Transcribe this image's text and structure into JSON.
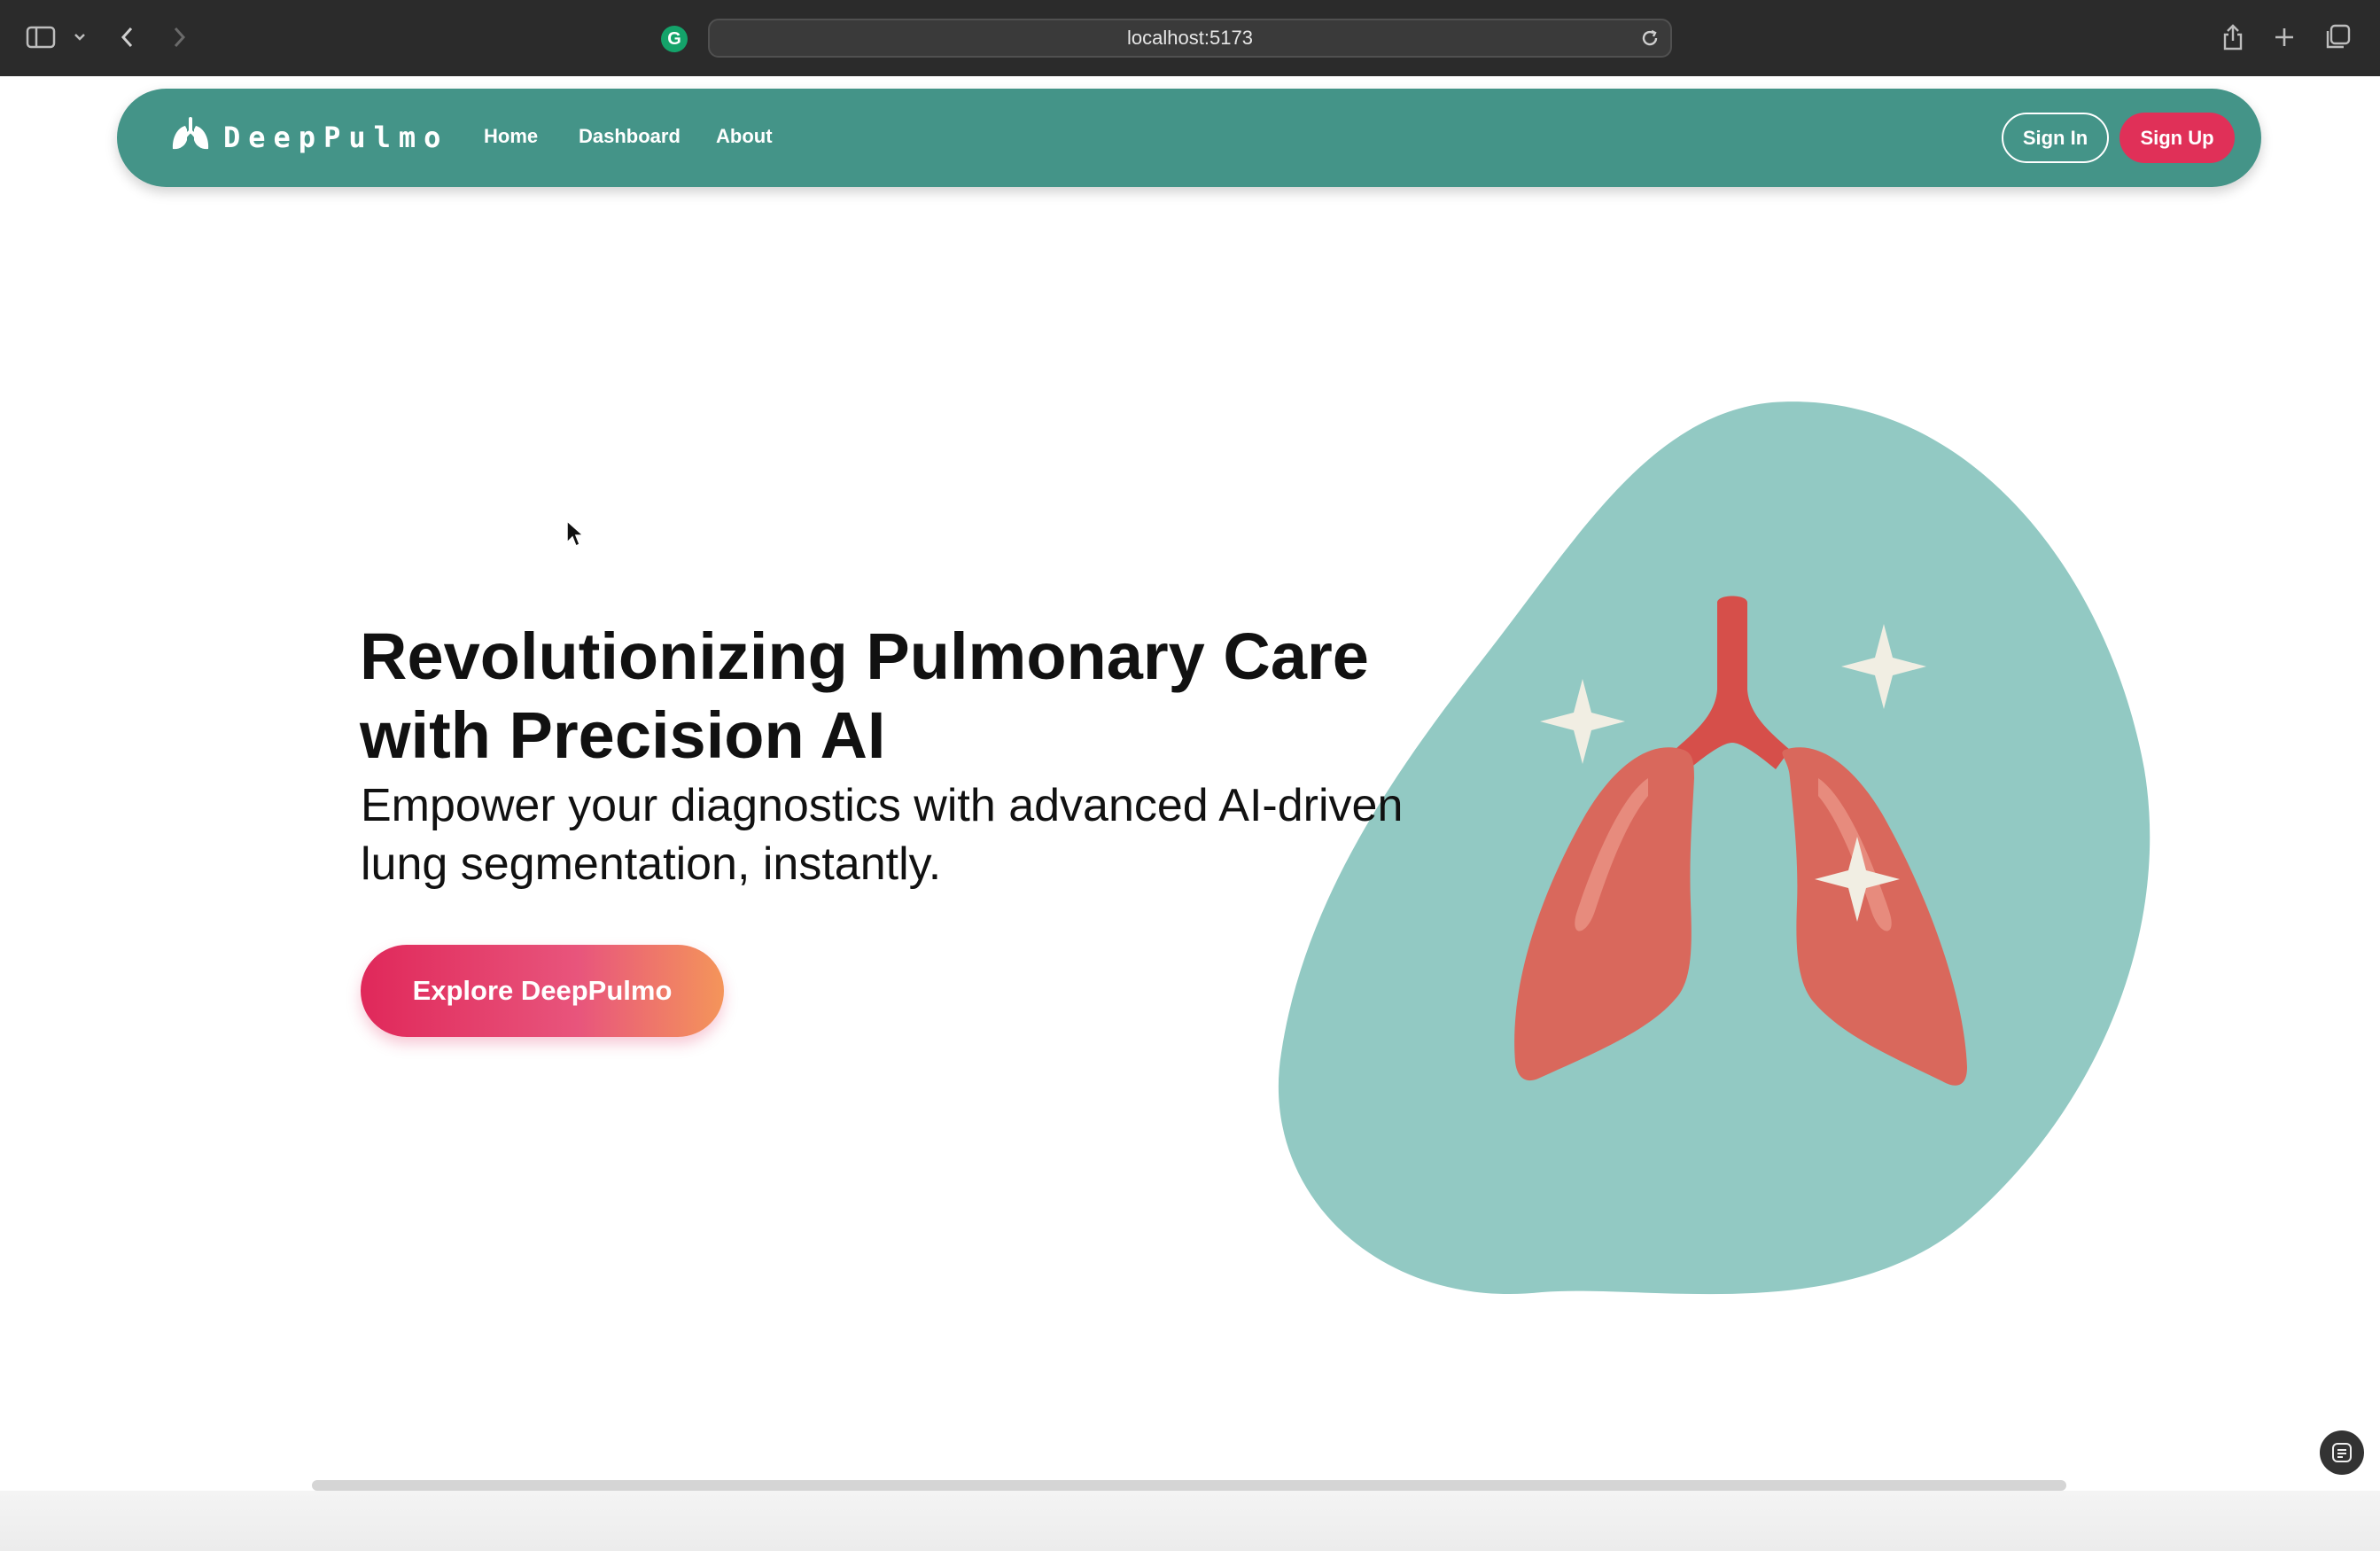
{
  "browser": {
    "url": "localhost:5173"
  },
  "nav": {
    "brand": "DeepPulmo",
    "links": [
      "Home",
      "Dashboard",
      "About"
    ],
    "sign_in": "Sign In",
    "sign_up": "Sign Up"
  },
  "hero": {
    "title_line1": "Revolutionizing Pulmonary Care",
    "title_line2": "with Precision AI",
    "subtitle_line1": "Empower your diagnostics with advanced AI-driven",
    "subtitle_line2": "lung segmentation, instantly.",
    "cta": "Explore DeepPulmo"
  },
  "colors": {
    "nav_bg": "#449488",
    "accent": "#e03058",
    "blob": "#92c9c3",
    "lung": "#d9685c"
  },
  "icons": [
    "sidebar-icon",
    "chevron-down-icon",
    "back-icon",
    "forward-icon",
    "grammarly-icon",
    "reload-icon",
    "share-icon",
    "new-tab-icon",
    "tabs-overview-icon",
    "lungs-logo-icon",
    "lungs-illustration",
    "sparkle-icon"
  ]
}
